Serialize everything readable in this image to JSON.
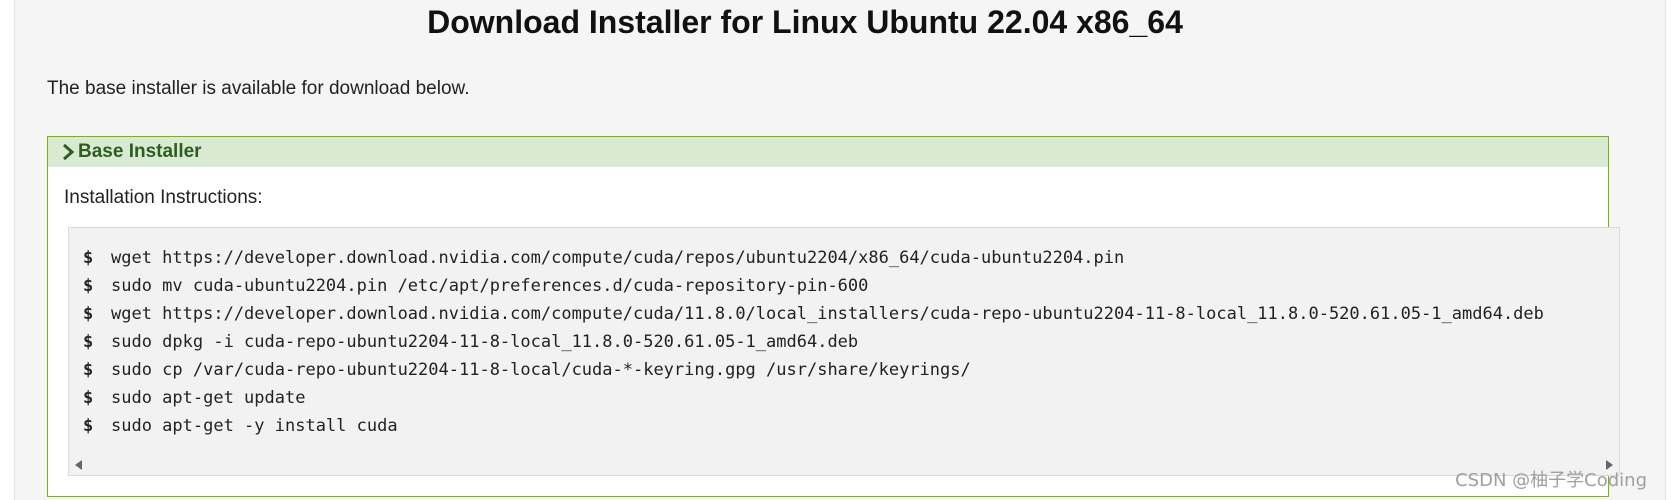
{
  "page": {
    "title": "Download Installer for Linux Ubuntu 22.04 x86_64",
    "intro": "The base installer is available for download below."
  },
  "panel": {
    "header_label": "Base Installer",
    "header_icon": "chevron-right-icon",
    "instructions_label": "Installation Instructions:",
    "prompt_symbol": "$",
    "commands": [
      "wget https://developer.download.nvidia.com/compute/cuda/repos/ubuntu2204/x86_64/cuda-ubuntu2204.pin",
      "sudo mv cuda-ubuntu2204.pin /etc/apt/preferences.d/cuda-repository-pin-600",
      "wget https://developer.download.nvidia.com/compute/cuda/11.8.0/local_installers/cuda-repo-ubuntu2204-11-8-local_11.8.0-520.61.05-1_amd64.deb",
      "sudo dpkg -i cuda-repo-ubuntu2204-11-8-local_11.8.0-520.61.05-1_amd64.deb",
      "sudo cp /var/cuda-repo-ubuntu2204-11-8-local/cuda-*-keyring.gpg /usr/share/keyrings/",
      "sudo apt-get update",
      "sudo apt-get -y install cuda"
    ]
  },
  "watermark": "CSDN @柚子学Coding",
  "colors": {
    "accent_border": "#76b900",
    "header_bg": "#d9ead3",
    "header_text": "#2f5d1f"
  }
}
